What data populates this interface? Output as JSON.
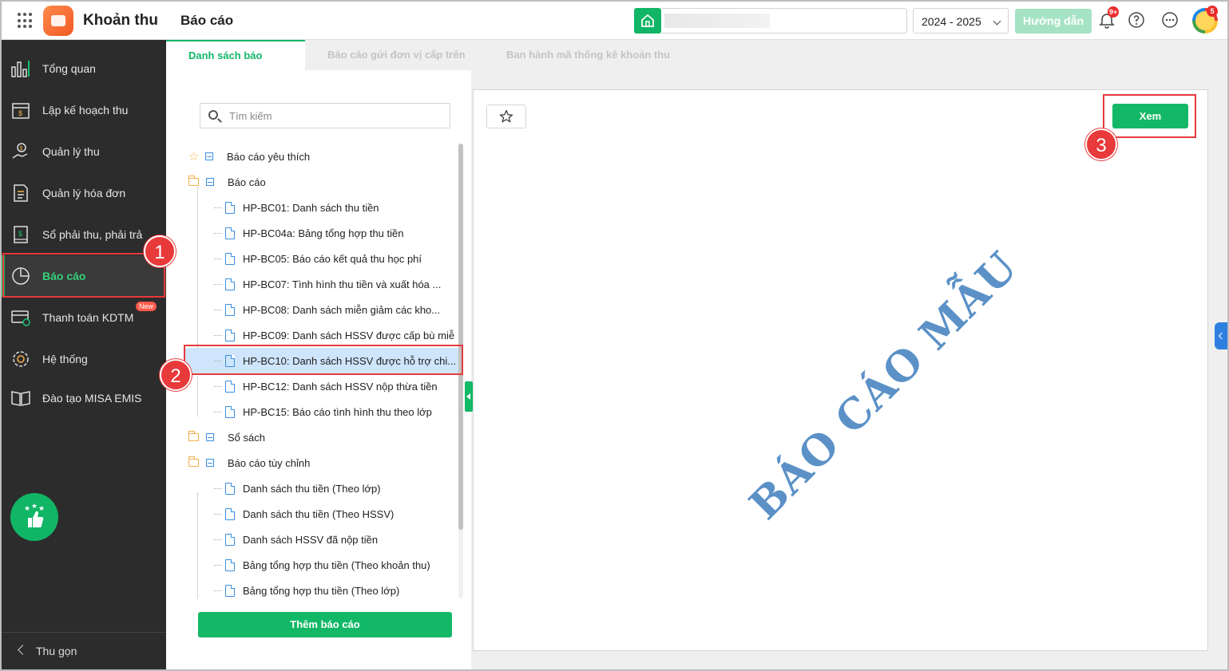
{
  "header": {
    "app_name": "Khoản thu",
    "page_title": "Báo cáo",
    "school_value": "",
    "year": "2024 - 2025",
    "guide_label": "Hướng dẫn",
    "notifications_badge": "9+",
    "avatar_badge": "5",
    "colors": {
      "brand": "#13b867",
      "logo": "#f15a24"
    }
  },
  "sidebar": {
    "items": [
      {
        "label": "Tổng quan",
        "icon": "chart-bars-icon"
      },
      {
        "label": "Lập kế hoạch thu",
        "icon": "calendar-money-icon"
      },
      {
        "label": "Quản lý thu",
        "icon": "hand-coin-icon"
      },
      {
        "label": "Quản lý hóa đơn",
        "icon": "invoice-icon"
      },
      {
        "label": "Sổ phải thu, phải trả",
        "icon": "ledger-icon"
      },
      {
        "label": "Báo cáo",
        "icon": "pie-chart-icon",
        "active": true
      },
      {
        "label": "Thanh toán KDTM",
        "icon": "card-check-icon",
        "badge": "New"
      },
      {
        "label": "Hệ thống",
        "icon": "gear-icon"
      },
      {
        "label": "Đào tạo MISA EMIS",
        "icon": "book-icon"
      }
    ],
    "collapse_label": "Thu gọn"
  },
  "tabs": [
    {
      "label": "Danh sách báo cáo",
      "active": true
    },
    {
      "label": "Báo cáo gửi đơn vị cấp trên"
    },
    {
      "label": "Ban hành mã thống kê khoản thu"
    }
  ],
  "search": {
    "placeholder": "Tìm kiếm"
  },
  "tree": {
    "favorites": "Báo cáo yêu thích",
    "group_reports": "Báo cáo",
    "reports": [
      "HP-BC01: Danh sách thu tiền",
      "HP-BC04a: Bảng tổng hợp thu tiền",
      "HP-BC05: Báo cáo kết quả thu học phí",
      "HP-BC07: Tình hình thu tiền và xuất hóa ...",
      "HP-BC08: Danh sách miễn giảm các kho...",
      "HP-BC09: Danh sách HSSV được cấp bù miễ",
      "HP-BC10: Danh sách HSSV được hỗ trợ chi...",
      "HP-BC12: Danh sách HSSV nộp thừa tiền",
      "HP-BC15: Báo cáo tình hình thu theo lớp"
    ],
    "selected_index": 6,
    "group_books": "Sổ sách",
    "group_custom": "Báo cáo tùy chỉnh",
    "custom": [
      "Danh sách thu tiền (Theo lớp)",
      "Danh sách thu tiền (Theo HSSV)",
      "Danh sách HSSV đã nộp tiền",
      "Bảng tổng hợp thu tiền (Theo khoản thu)",
      "Bảng tổng hợp thu tiền (Theo lớp)"
    ]
  },
  "add_report_label": "Thêm báo cáo",
  "preview": {
    "view_label": "Xem",
    "watermark": "BÁO CÁO MẪU"
  },
  "annotations": [
    "1",
    "2",
    "3"
  ]
}
